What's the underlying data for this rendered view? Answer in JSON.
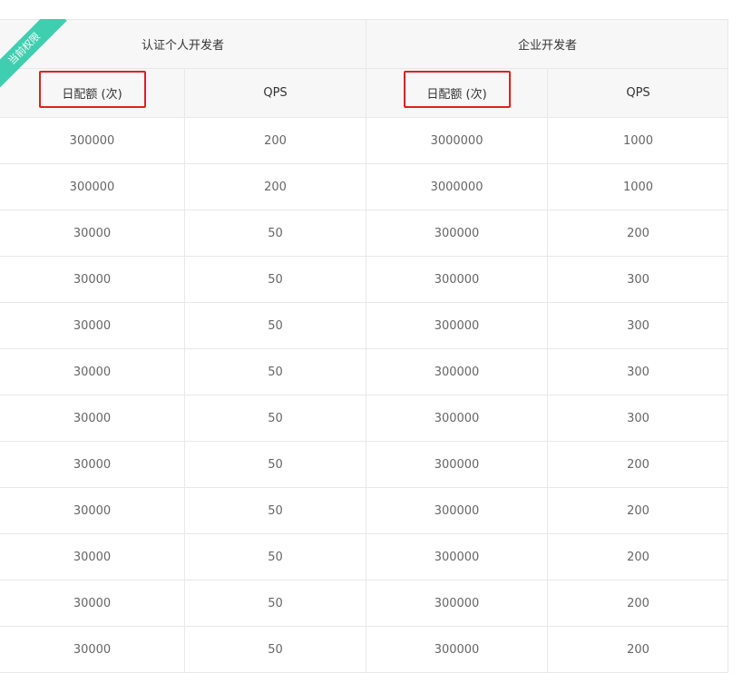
{
  "ribbon": {
    "label": "当前权限"
  },
  "header": {
    "groups": [
      "认证个人开发者",
      "企业开发者"
    ],
    "columns": [
      "日配额 (次)",
      "QPS",
      "日配额 (次)",
      "QPS"
    ]
  },
  "rows": [
    [
      "300000",
      "200",
      "3000000",
      "1000"
    ],
    [
      "300000",
      "200",
      "3000000",
      "1000"
    ],
    [
      "30000",
      "50",
      "300000",
      "200"
    ],
    [
      "30000",
      "50",
      "300000",
      "300"
    ],
    [
      "30000",
      "50",
      "300000",
      "300"
    ],
    [
      "30000",
      "50",
      "300000",
      "300"
    ],
    [
      "30000",
      "50",
      "300000",
      "300"
    ],
    [
      "30000",
      "50",
      "300000",
      "200"
    ],
    [
      "30000",
      "50",
      "300000",
      "200"
    ],
    [
      "30000",
      "50",
      "300000",
      "200"
    ],
    [
      "30000",
      "50",
      "300000",
      "200"
    ],
    [
      "30000",
      "50",
      "300000",
      "200"
    ]
  ],
  "colors": {
    "ribbon": "#3fcfb0",
    "highlight": "#e02020",
    "header_bg": "#f7f7f7"
  }
}
